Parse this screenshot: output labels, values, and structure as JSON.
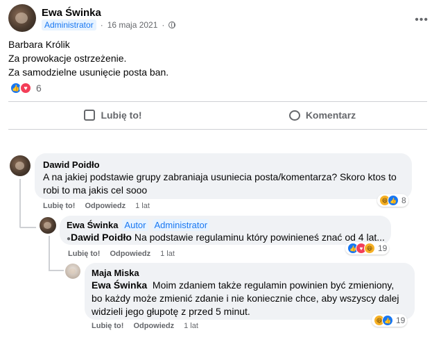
{
  "post": {
    "author": "Ewa Świnka",
    "role": "Administrator",
    "date": "16 maja 2021",
    "more": "•••",
    "lines": [
      "Barbara Królik",
      "Za prowokacje ostrzeżenie.",
      "Za samodzielne usunięcie posta ban."
    ],
    "reaction_count": "6"
  },
  "actions": {
    "like": "Lubię to!",
    "comment": "Komentarz"
  },
  "comments": [
    {
      "author": "Dawid Poidło",
      "text_line1": "A na jakiej podstawie grupy zabraniaja usuniecia posta/komentarza? Skoro ktos to",
      "text_line2": "robi to ma jakis cel sooo",
      "like": "Lubię to!",
      "reply": "Odpowiedz",
      "time": "1 lat",
      "reaction_count": "8"
    },
    {
      "author": "Ewa Świnka",
      "tag1": "Autor",
      "tag2": "Administrator",
      "mention": "Dawid Poidło",
      "text": " Na podstawie regulaminu który powinieneś znać od 4 lat...",
      "like": "Lubię to!",
      "reply": "Odpowiedz",
      "time": "1 lat",
      "reaction_count": "19"
    },
    {
      "author": "Maja Miska",
      "mention": "Ewa Świnka",
      "text_line1": "  Moim zdaniem także regulamin powinien być zmieniony,",
      "text_line2": "bo każdy może zmienić zdanie i nie koniecznie chce, aby wszyscy dalej",
      "text_line3": "widzieli jego głupotę z przed 5 minut.",
      "like": "Lubię to!",
      "reply": "Odpowiedz",
      "time": "1 lat",
      "reaction_count": "19"
    }
  ],
  "colors": {
    "accent": "#1877f2",
    "text_secondary": "#65676b",
    "bubble": "#f0f2f5",
    "love": "#f33e58",
    "haha": "#f7b125"
  },
  "icons": [
    "avatar",
    "globe-icon",
    "more-icon",
    "like-icon",
    "love-icon",
    "haha-icon",
    "thumb-up-icon",
    "comment-icon"
  ]
}
